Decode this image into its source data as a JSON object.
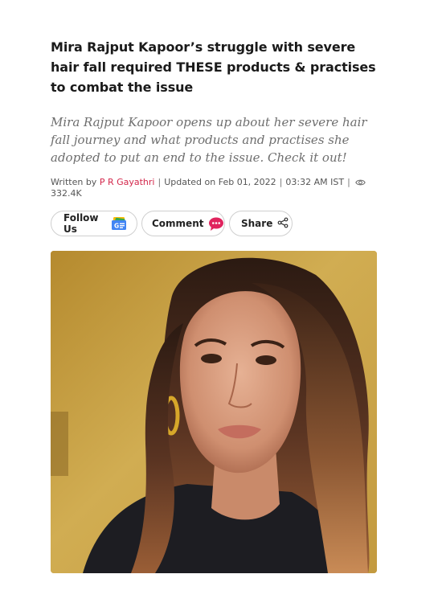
{
  "article": {
    "headline": "Mira Rajput Kapoor’s struggle with severe hair fall required THESE products & practises to combat the issue",
    "summary": "Mira Rajput Kapoor opens up about her severe hair fall journey and what products and practises she adopted to put an end to the issue. Check it out!",
    "meta": {
      "written_by_label": "Written by",
      "author": "P R Gayathri",
      "sep": "|",
      "updated": "Updated on Feb 01, 2022",
      "time": "03:32 AM IST",
      "views": "332.4K",
      "views_icon": "eye-icon"
    },
    "actions": {
      "follow_label": "Follow Us",
      "follow_icon": "google-news-icon",
      "comment_label": "Comment",
      "comment_icon": "chat-bubble-icon",
      "share_label": "Share",
      "share_icon": "share-icon"
    },
    "colors": {
      "author": "#d3274b",
      "comment_icon": "#e0245e",
      "summary_text": "#6e6e6e"
    }
  }
}
